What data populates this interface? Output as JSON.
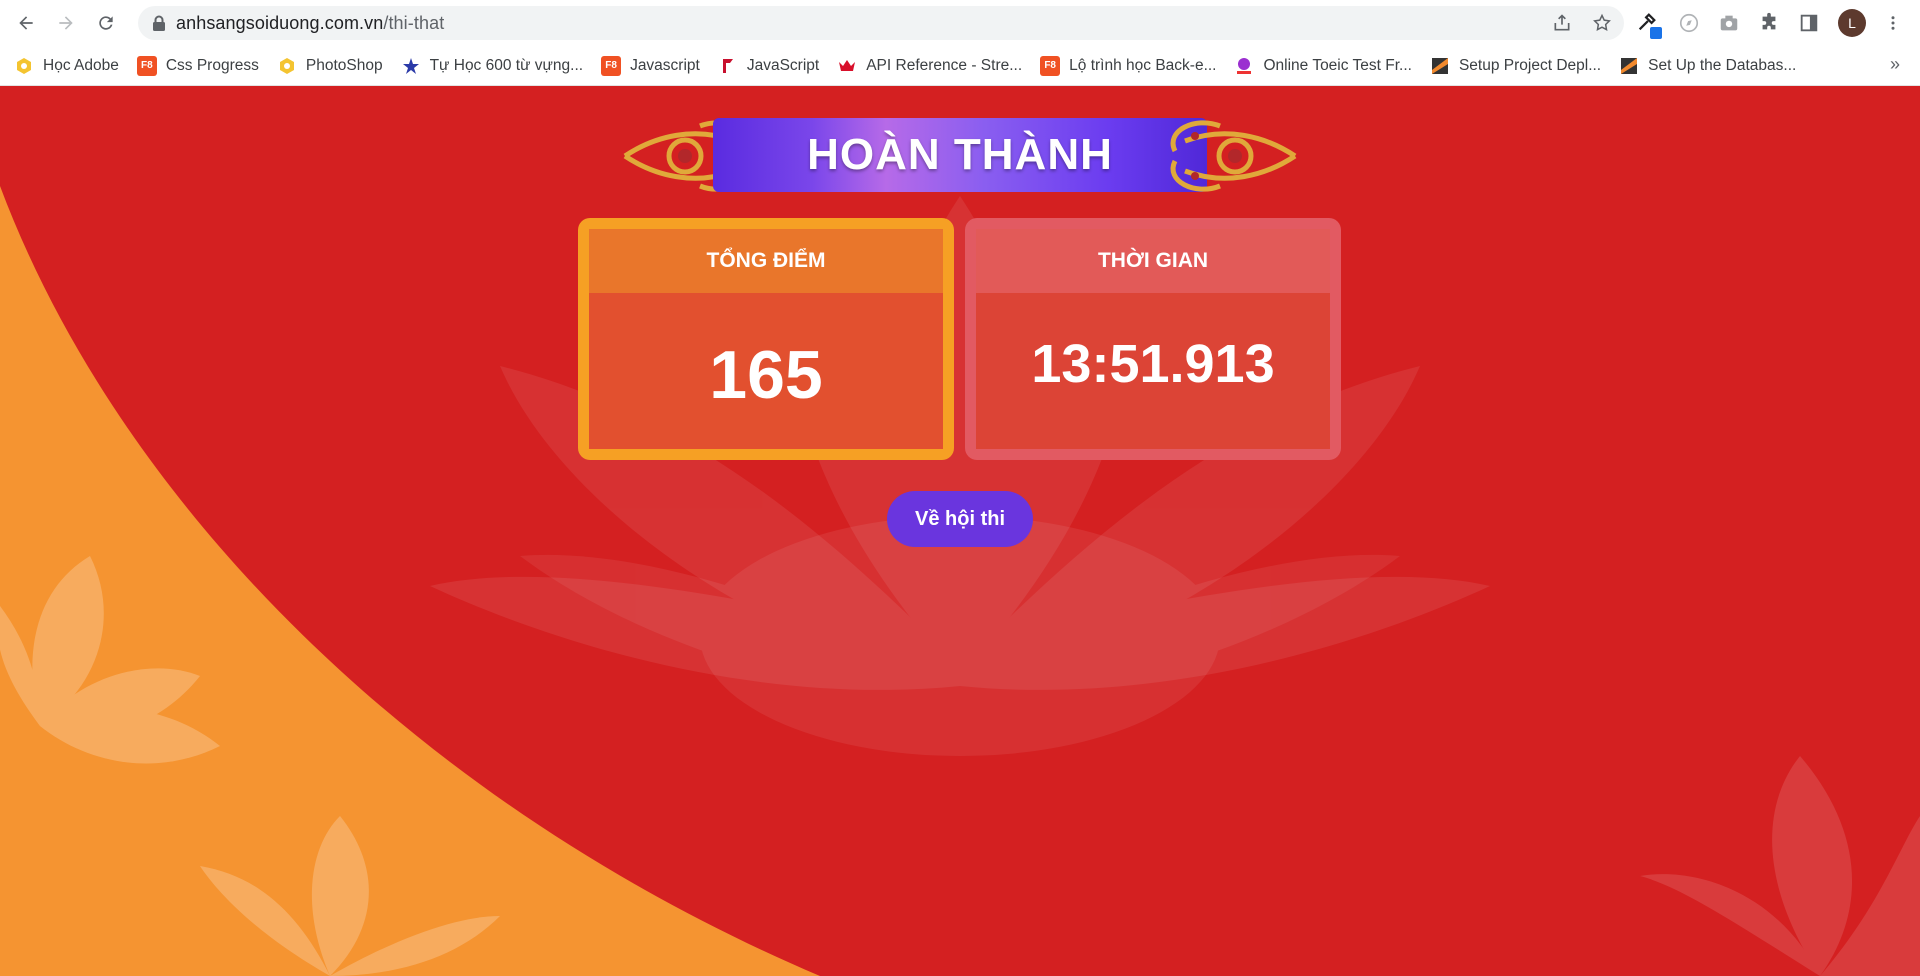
{
  "browser": {
    "url_host": "anhsangsoiduong.com.vn",
    "url_path": "/thi-that",
    "avatar_letter": "L",
    "bookmarks": [
      {
        "label": "Học Adobe",
        "icon": "adobe-yellow-icon"
      },
      {
        "label": "Css Progress",
        "icon": "f8-icon"
      },
      {
        "label": "PhotoShop",
        "icon": "adobe-yellow-icon"
      },
      {
        "label": "Tự Học 600 từ vựng...",
        "icon": "star-runner-icon"
      },
      {
        "label": "Javascript",
        "icon": "f8-icon"
      },
      {
        "label": "JavaScript",
        "icon": "red-flag-icon"
      },
      {
        "label": "API Reference - Stre...",
        "icon": "crown-icon"
      },
      {
        "label": "Lộ trình học Back-e...",
        "icon": "f8-icon"
      },
      {
        "label": "Online Toeic Test Fr...",
        "icon": "toeic-icon"
      },
      {
        "label": "Setup Project Depl...",
        "icon": "slash-icon"
      },
      {
        "label": "Set Up the Databas...",
        "icon": "slash-icon"
      }
    ],
    "more_label": "»"
  },
  "page": {
    "title": "HOÀN THÀNH",
    "score_label": "TỔNG ĐIỂM",
    "score_value": "165",
    "time_label": "THỜI GIAN",
    "time_value": "13:51.913",
    "back_button": "Về hội thi"
  },
  "colors": {
    "background": "#d42021",
    "accent_orange": "#f6a024",
    "button_purple": "#6a35de"
  }
}
